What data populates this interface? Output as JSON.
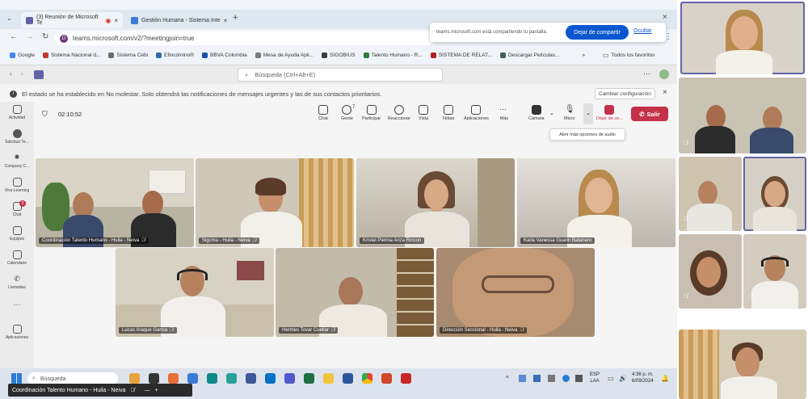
{
  "browser": {
    "tabs": [
      {
        "label": "(3) Reunión de Microsoft Te",
        "active": true
      },
      {
        "label": "Gestión Humana - Sistema Inte",
        "active": false
      }
    ],
    "url": "teams.microsoft.com/v2/?meetingjoin=true",
    "profile_initial": "D",
    "bookmarks": [
      "Google",
      "Sistema Nacional d...",
      "Sistema Cebi",
      "Efincómino®",
      "BBVA Colombia",
      "Mesa de Ayuda Apli...",
      "SIGOBIUS",
      "Talento Humano - R...",
      "SISTEMA DE RELAT...",
      "Descargar Películas..."
    ],
    "bookmarks_more": "»",
    "all_bookmarks": "Todos los favoritos"
  },
  "share_popup": {
    "text": "teams.microsoft.com está compartiendo tu pantalla.",
    "stop_button": "Dejar de compartir",
    "hide_link": "Ocultar"
  },
  "teams": {
    "search_placeholder": "Búsqueda (Ctrl+Alt+E)",
    "more": "···",
    "notice_text": "El estado se ha establecido en No molestar. Solo obtendrá las notificaciones de mensajes urgentes y las de sus contactos prioritarios.",
    "notice_button": "Cambiar configuración",
    "rail": [
      {
        "label": "Actividad",
        "icon": "bell-icon"
      },
      {
        "label": "Solicitud Te...",
        "icon": "app-icon"
      },
      {
        "label": "Company C...",
        "icon": "app-icon"
      },
      {
        "label": "Viva Learning",
        "icon": "book-icon"
      },
      {
        "label": "Chat",
        "icon": "chat-icon",
        "badge": "3"
      },
      {
        "label": "Equipos",
        "icon": "teams-icon"
      },
      {
        "label": "Calendario",
        "icon": "calendar-icon"
      },
      {
        "label": "Llamadas",
        "icon": "phone-icon"
      },
      {
        "label": "···",
        "icon": "more-icon"
      },
      {
        "label": "Aplicaciones",
        "icon": "apps-icon"
      }
    ],
    "meeting": {
      "timer": "02:10:52",
      "controls": [
        {
          "label": "Chat",
          "icon": "chat-icon"
        },
        {
          "label": "Gente",
          "icon": "people-icon",
          "count": "7"
        },
        {
          "label": "Participar",
          "icon": "hand-icon"
        },
        {
          "label": "Reaccionar",
          "icon": "emoji-icon"
        },
        {
          "label": "Vista",
          "icon": "grid-icon"
        },
        {
          "label": "Notas",
          "icon": "notes-icon"
        },
        {
          "label": "Aplicaciones",
          "icon": "plus-icon"
        },
        {
          "label": "Más",
          "icon": "more-icon"
        },
        {
          "label": "Cámara",
          "icon": "camera-icon"
        },
        {
          "label": "Micro",
          "icon": "mic-off-icon"
        },
        {
          "label": "Dejar de co...",
          "icon": "stop-share-icon"
        }
      ],
      "leave_label": "Salir",
      "tooltip": "Abrir más opciones de audio"
    },
    "participants": [
      {
        "name": "Coordinación Talento Humano - Huila - Neiva",
        "muted": true
      },
      {
        "name": "Sigcma - Huila - Neiva",
        "muted": true
      },
      {
        "name": "Kristel Pierina Ariza Rincon",
        "muted": false
      },
      {
        "name": "Karla Vanessa Guarin Batanero",
        "muted": false
      },
      {
        "name": "Lucas Araque Garcia",
        "muted": true
      },
      {
        "name": "Hermes Tovar Cuellar",
        "muted": true
      },
      {
        "name": "Dirección Seccional - Huila - Neiva",
        "muted": true
      }
    ]
  },
  "taskbar": {
    "search_placeholder": "Búsqueda",
    "lang_top": "ESP",
    "lang_bottom": "LAA",
    "time": "4:36 p. m.",
    "date": "6/09/2024"
  },
  "pip": {
    "title": "Coordinación Talento Humano - Huila - Neiva",
    "minus": "—",
    "plus": "+"
  },
  "colors": {
    "teams_purple": "#6264a7",
    "leave_red": "#c4314b",
    "chrome_blue": "#0b57d0"
  }
}
